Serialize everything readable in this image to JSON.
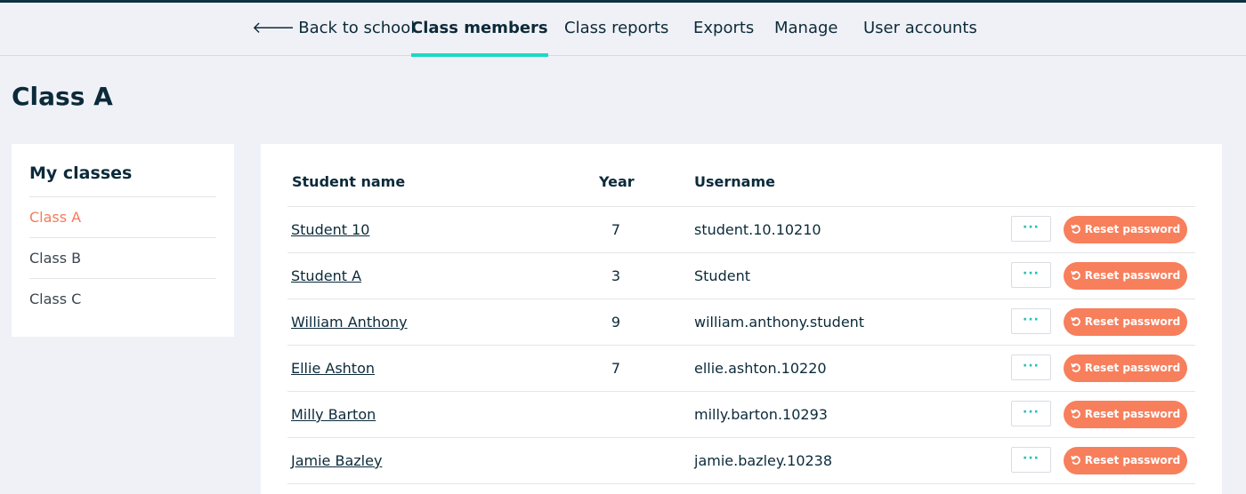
{
  "nav": {
    "back_label": "Back to school",
    "items": [
      {
        "label": "Class members",
        "active": true
      },
      {
        "label": "Class reports",
        "active": false
      },
      {
        "label": "Exports",
        "active": false
      },
      {
        "label": "Manage",
        "active": false
      },
      {
        "label": "User accounts",
        "active": false
      }
    ]
  },
  "page": {
    "title": "Class A"
  },
  "sidebar": {
    "title": "My classes",
    "items": [
      {
        "label": "Class A",
        "active": true
      },
      {
        "label": "Class B",
        "active": false
      },
      {
        "label": "Class C",
        "active": false
      }
    ]
  },
  "table": {
    "headers": {
      "name": "Student name",
      "year": "Year",
      "username": "Username"
    },
    "more_label": "···",
    "reset_label": "Reset password",
    "rows": [
      {
        "name": "Student 10",
        "year": "7",
        "username": "student.10.10210"
      },
      {
        "name": "Student A",
        "year": "3",
        "username": "Student"
      },
      {
        "name": "William Anthony",
        "year": "9",
        "username": "william.anthony.student"
      },
      {
        "name": "Ellie Ashton",
        "year": "7",
        "username": "ellie.ashton.10220"
      },
      {
        "name": "Milly Barton",
        "year": "",
        "username": "milly.barton.10293"
      },
      {
        "name": "Jamie Bazley",
        "year": "",
        "username": "jamie.bazley.10238"
      }
    ]
  },
  "colors": {
    "accent": "#1ed8c3",
    "reset_button": "#f77f5c",
    "active_class": "#f47c5a"
  }
}
